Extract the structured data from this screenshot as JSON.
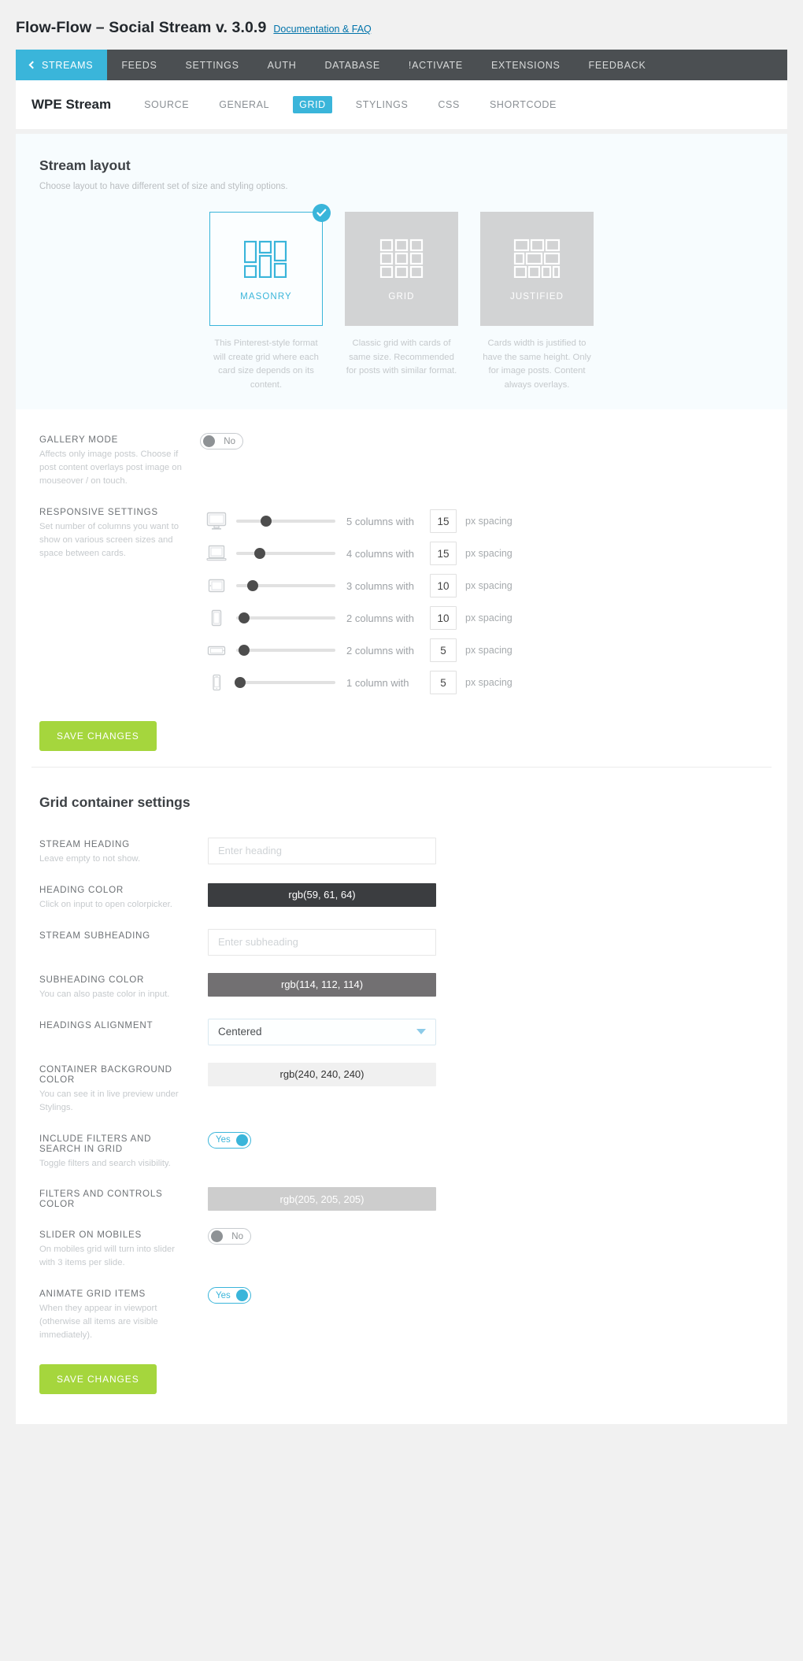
{
  "header": {
    "plugin_title": "Flow-Flow – Social Stream v. 3.0.9",
    "doc_link": "Documentation & FAQ"
  },
  "topnav": {
    "items": [
      {
        "label": "STREAMS",
        "active": true,
        "icon": "chevron-left-icon"
      },
      {
        "label": "FEEDS",
        "active": false
      },
      {
        "label": "SETTINGS",
        "active": false
      },
      {
        "label": "AUTH",
        "active": false
      },
      {
        "label": "DATABASE",
        "active": false
      },
      {
        "label": "!ACTIVATE",
        "active": false
      },
      {
        "label": "EXTENSIONS",
        "active": false
      },
      {
        "label": "FEEDBACK",
        "active": false
      }
    ]
  },
  "subnav": {
    "stream_name": "WPE Stream",
    "items": [
      {
        "label": "SOURCE",
        "active": false
      },
      {
        "label": "GENERAL",
        "active": false
      },
      {
        "label": "GRID",
        "active": true
      },
      {
        "label": "STYLINGS",
        "active": false
      },
      {
        "label": "CSS",
        "active": false
      },
      {
        "label": "SHORTCODE",
        "active": false
      }
    ]
  },
  "stream_layout": {
    "title": "Stream layout",
    "subtitle": "Choose layout to have different set of size and styling options.",
    "cards": [
      {
        "label": "MASONRY",
        "selected": true,
        "description": "This Pinterest-style format will create grid where each card size depends on its content."
      },
      {
        "label": "GRID",
        "selected": false,
        "description": "Classic grid with cards of same size. Recommended for posts with similar format."
      },
      {
        "label": "JUSTIFIED",
        "selected": false,
        "description": "Cards width is justified to have the same height. Only for image posts. Content always overlays."
      }
    ]
  },
  "gallery_mode": {
    "label": "GALLERY MODE",
    "hint": "Affects only image posts. Choose if post content overlays post image on mouseover / on touch.",
    "toggle_value": "No",
    "toggle_on": false
  },
  "responsive": {
    "label": "RESPONSIVE SETTINGS",
    "hint": "Set number of columns you want to show on various screen sizes and space between cards.",
    "px_label": "px spacing",
    "rows": [
      {
        "device": "desktop-icon",
        "columns_text": "5 columns with",
        "slider_pct": 30,
        "spacing": "15"
      },
      {
        "device": "laptop-icon",
        "columns_text": "4 columns with",
        "slider_pct": 24,
        "spacing": "15"
      },
      {
        "device": "tablet-icon",
        "columns_text": "3 columns with",
        "slider_pct": 17,
        "spacing": "10"
      },
      {
        "device": "tablet-portrait-icon",
        "columns_text": "2 columns with",
        "slider_pct": 8,
        "spacing": "10"
      },
      {
        "device": "phone-landscape-icon",
        "columns_text": "2 columns with",
        "slider_pct": 8,
        "spacing": "5"
      },
      {
        "device": "phone-icon",
        "columns_text": "1 column with",
        "slider_pct": 4,
        "spacing": "5"
      }
    ]
  },
  "save_top": {
    "label": "SAVE CHANGES"
  },
  "grid_container": {
    "title": "Grid container settings",
    "stream_heading": {
      "label": "STREAM HEADING",
      "hint": "Leave empty to not show.",
      "value": "",
      "placeholder": "Enter heading"
    },
    "heading_color": {
      "label": "HEADING COLOR",
      "hint": "Click on input to open colorpicker.",
      "value": "rgb(59, 61, 64)",
      "bg": "#3b3d40",
      "fg": "#ffffff"
    },
    "stream_subheading": {
      "label": "STREAM SUBHEADING",
      "hint": "",
      "value": "",
      "placeholder": "Enter subheading"
    },
    "subheading_color": {
      "label": "SUBHEADING COLOR",
      "hint": "You can also paste color in input.",
      "value": "rgb(114, 112, 114)",
      "bg": "#727072",
      "fg": "#ffffff"
    },
    "headings_alignment": {
      "label": "HEADINGS ALIGNMENT",
      "hint": "",
      "value": "Centered"
    },
    "container_bg_color": {
      "label": "CONTAINER BACKGROUND COLOR",
      "hint": "You can see it in live preview under Stylings.",
      "value": "rgb(240, 240, 240)",
      "bg": "#f0f0f0",
      "fg": "#333333"
    },
    "include_filters": {
      "label": "INCLUDE FILTERS AND SEARCH IN GRID",
      "hint": "Toggle filters and search visibility.",
      "toggle_value": "Yes",
      "toggle_on": true
    },
    "filters_color": {
      "label": "FILTERS AND CONTROLS COLOR",
      "hint": "",
      "value": "rgb(205, 205, 205)",
      "bg": "#cdcdcd",
      "fg": "#ffffff"
    },
    "slider_on_mobiles": {
      "label": "SLIDER ON MOBILES",
      "hint": "On mobiles grid will turn into slider with 3 items per slide.",
      "toggle_value": "No",
      "toggle_on": false
    },
    "animate_grid_items": {
      "label": "ANIMATE GRID ITEMS",
      "hint": "When they appear in viewport (otherwise all items are visible immediately).",
      "toggle_value": "Yes",
      "toggle_on": true
    }
  },
  "save_bottom": {
    "label": "SAVE CHANGES"
  },
  "colors": {
    "accent": "#3ab5da",
    "nav_bg": "#4b4f52",
    "save_green": "#a5d63d"
  }
}
